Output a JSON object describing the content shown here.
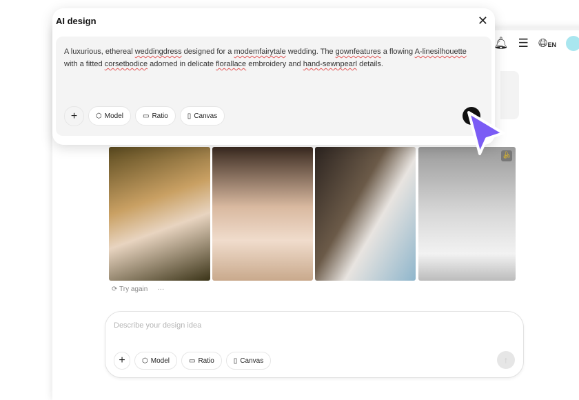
{
  "modal": {
    "title": "AI design",
    "prompt_segments": [
      {
        "t": "A luxurious, ethereal "
      },
      {
        "t": "weddingdress",
        "s": 1
      },
      {
        "t": " designed for a "
      },
      {
        "t": "modemfairytale",
        "s": 1
      },
      {
        "t": " wedding. The "
      },
      {
        "t": "gownfeatures",
        "s": 1
      },
      {
        "t": " a flowing "
      },
      {
        "t": "A-linesilhouette",
        "s": 1
      },
      {
        "t": " with a fitted "
      },
      {
        "t": "corsetbodice",
        "s": 1
      },
      {
        "t": " adorned in delicate "
      },
      {
        "t": "florallace",
        "s": 1
      },
      {
        "t": " embroidery and "
      },
      {
        "t": "hand-sewnpearl",
        "s": 1
      },
      {
        "t": " details."
      }
    ],
    "tools": {
      "model": "Model",
      "ratio": "Ratio",
      "canvas": "Canvas"
    }
  },
  "header": {
    "language": "EN"
  },
  "results": {
    "try_again": "Try again",
    "more": "···"
  },
  "composer": {
    "placeholder": "Describe your design idea",
    "tools": {
      "model": "Model",
      "ratio": "Ratio",
      "canvas": "Canvas"
    }
  },
  "colors": {
    "cursor": "#7b5cf5"
  }
}
